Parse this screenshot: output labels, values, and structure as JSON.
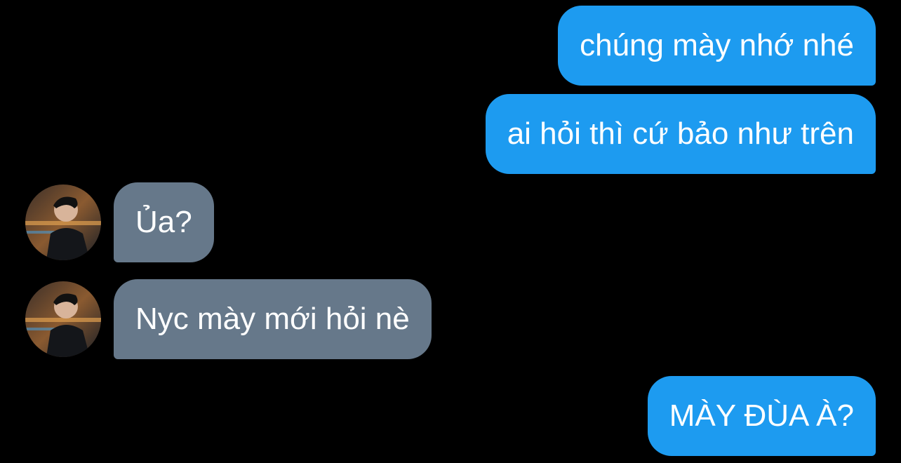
{
  "conversation": {
    "messages": [
      {
        "direction": "outgoing",
        "text": "chúng mày nhớ nhé"
      },
      {
        "direction": "outgoing",
        "text": "ai hỏi thì cứ bảo như trên"
      },
      {
        "direction": "incoming",
        "text": "Ủa?",
        "avatar": "user-avatar"
      },
      {
        "direction": "incoming",
        "text": "Nyc mày mới hỏi nè",
        "avatar": "user-avatar"
      },
      {
        "direction": "outgoing",
        "text": "MÀY ĐÙA À?"
      }
    ]
  },
  "colors": {
    "background": "#000000",
    "outgoing_bubble": "#1d9bf0",
    "incoming_bubble": "#66788a",
    "text": "#ffffff"
  }
}
